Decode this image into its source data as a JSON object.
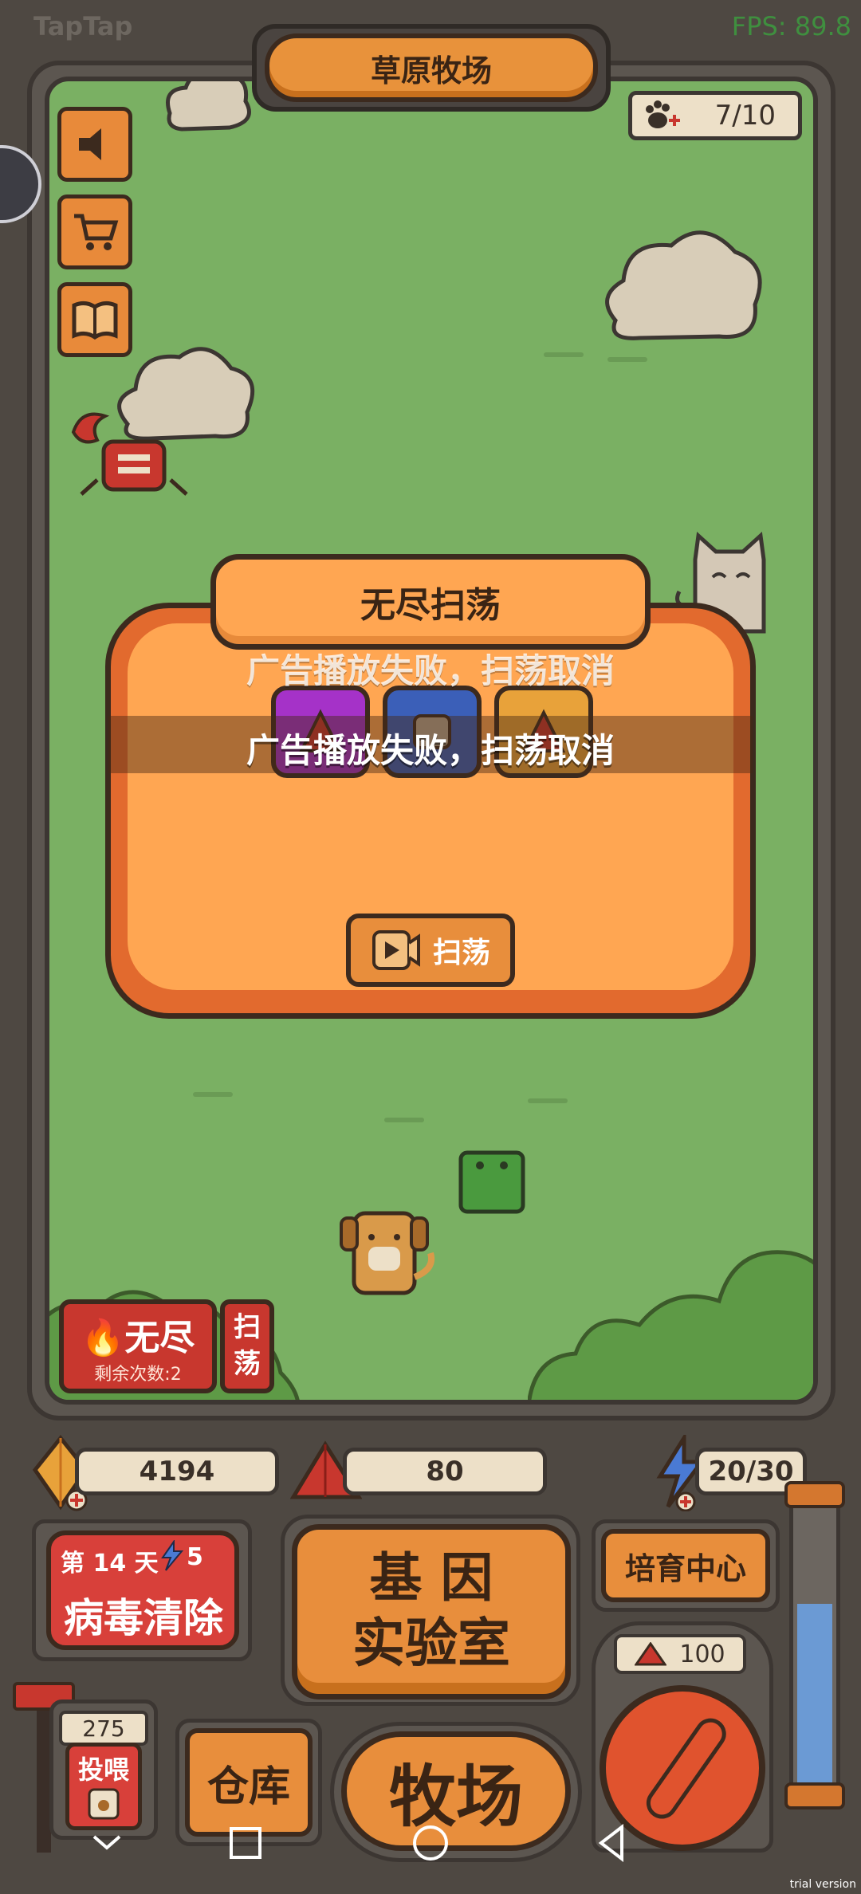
{
  "status": {
    "app_brand": "TapTap",
    "fps": "FPS: 89.8"
  },
  "header": {
    "title": "草原牧场",
    "capacity": "7/10"
  },
  "side_buttons": [
    {
      "icon": "speaker-icon"
    },
    {
      "icon": "cart-icon"
    },
    {
      "icon": "book-icon"
    }
  ],
  "popup": {
    "title": "无尽扫荡",
    "toast_message": "广告播放失败，扫荡取消",
    "sweep_button": "扫荡",
    "rewards": [
      {
        "color": "#a532c8",
        "icon": "purple-gem-icon"
      },
      {
        "color": "#3b5fb8",
        "icon": "creature-card-icon"
      },
      {
        "color": "#e8a23a",
        "icon": "orange-gem-icon"
      }
    ]
  },
  "endless": {
    "label": "无尽",
    "remaining": "剩余次数:2",
    "sweep": "扫荡"
  },
  "resources": {
    "gold": "4194",
    "red_gem": "80",
    "energy": "20/30"
  },
  "virus": {
    "day": "第 14 天",
    "energy_cost": "5",
    "label": "病毒清除"
  },
  "lab": {
    "line1": "基 因",
    "line2": "实验室"
  },
  "breed": {
    "label": "培育中心"
  },
  "dial": {
    "cost": "100"
  },
  "feed": {
    "count": "275",
    "label": "投喂"
  },
  "storage": {
    "label": "仓库"
  },
  "ranch": {
    "label": "牧场"
  },
  "watermark": "trial version",
  "colors": {
    "grass": "#7ab063",
    "accent_orange": "#e88e3c",
    "accent_red": "#d8403a",
    "outline": "#3c2a1e"
  }
}
